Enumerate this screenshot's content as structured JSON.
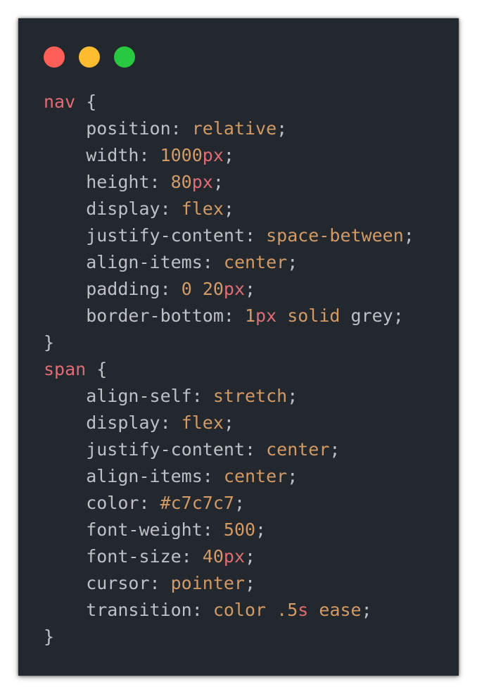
{
  "window": {
    "controls": [
      {
        "name": "close-dot",
        "color": "#ff5f57"
      },
      {
        "name": "minimize-dot",
        "color": "#febc2e"
      },
      {
        "name": "maximize-dot",
        "color": "#28c840"
      }
    ]
  },
  "colors": {
    "background": "#23272e",
    "selector": "#e06c75",
    "property": "#bdc1c6",
    "value": "#d19a66",
    "unit": "#e06c75"
  },
  "code": {
    "lines": [
      [
        {
          "t": "nav",
          "k": "sel"
        },
        {
          "t": " {",
          "k": "punc"
        }
      ],
      [
        {
          "t": "    position",
          "k": "prop"
        },
        {
          "t": ": ",
          "k": "punc"
        },
        {
          "t": "relative",
          "k": "val"
        },
        {
          "t": ";",
          "k": "punc"
        }
      ],
      [
        {
          "t": "    width",
          "k": "prop"
        },
        {
          "t": ": ",
          "k": "punc"
        },
        {
          "t": "1000",
          "k": "val"
        },
        {
          "t": "px",
          "k": "unit"
        },
        {
          "t": ";",
          "k": "punc"
        }
      ],
      [
        {
          "t": "    height",
          "k": "prop"
        },
        {
          "t": ": ",
          "k": "punc"
        },
        {
          "t": "80",
          "k": "val"
        },
        {
          "t": "px",
          "k": "unit"
        },
        {
          "t": ";",
          "k": "punc"
        }
      ],
      [
        {
          "t": "    display",
          "k": "prop"
        },
        {
          "t": ": ",
          "k": "punc"
        },
        {
          "t": "flex",
          "k": "val"
        },
        {
          "t": ";",
          "k": "punc"
        }
      ],
      [
        {
          "t": "    justify-content",
          "k": "prop"
        },
        {
          "t": ": ",
          "k": "punc"
        },
        {
          "t": "space-between",
          "k": "val"
        },
        {
          "t": ";",
          "k": "punc"
        }
      ],
      [
        {
          "t": "    align-items",
          "k": "prop"
        },
        {
          "t": ": ",
          "k": "punc"
        },
        {
          "t": "center",
          "k": "val"
        },
        {
          "t": ";",
          "k": "punc"
        }
      ],
      [
        {
          "t": "    padding",
          "k": "prop"
        },
        {
          "t": ": ",
          "k": "punc"
        },
        {
          "t": "0",
          "k": "val"
        },
        {
          "t": " ",
          "k": "punc"
        },
        {
          "t": "20",
          "k": "val"
        },
        {
          "t": "px",
          "k": "unit"
        },
        {
          "t": ";",
          "k": "punc"
        }
      ],
      [
        {
          "t": "    border-bottom",
          "k": "prop"
        },
        {
          "t": ": ",
          "k": "punc"
        },
        {
          "t": "1",
          "k": "val"
        },
        {
          "t": "px",
          "k": "unit"
        },
        {
          "t": " ",
          "k": "punc"
        },
        {
          "t": "solid",
          "k": "val"
        },
        {
          "t": " grey;",
          "k": "punc"
        }
      ],
      [
        {
          "t": "}",
          "k": "punc"
        }
      ],
      [
        {
          "t": "span",
          "k": "sel"
        },
        {
          "t": " {",
          "k": "punc"
        }
      ],
      [
        {
          "t": "    align-self",
          "k": "prop"
        },
        {
          "t": ": ",
          "k": "punc"
        },
        {
          "t": "stretch",
          "k": "val"
        },
        {
          "t": ";",
          "k": "punc"
        }
      ],
      [
        {
          "t": "    display",
          "k": "prop"
        },
        {
          "t": ": ",
          "k": "punc"
        },
        {
          "t": "flex",
          "k": "val"
        },
        {
          "t": ";",
          "k": "punc"
        }
      ],
      [
        {
          "t": "    justify-content",
          "k": "prop"
        },
        {
          "t": ": ",
          "k": "punc"
        },
        {
          "t": "center",
          "k": "val"
        },
        {
          "t": ";",
          "k": "punc"
        }
      ],
      [
        {
          "t": "    align-items",
          "k": "prop"
        },
        {
          "t": ": ",
          "k": "punc"
        },
        {
          "t": "center",
          "k": "val"
        },
        {
          "t": ";",
          "k": "punc"
        }
      ],
      [
        {
          "t": "    color",
          "k": "prop"
        },
        {
          "t": ": ",
          "k": "punc"
        },
        {
          "t": "#c7c7c7",
          "k": "val"
        },
        {
          "t": ";",
          "k": "punc"
        }
      ],
      [
        {
          "t": "    font-weight",
          "k": "prop"
        },
        {
          "t": ": ",
          "k": "punc"
        },
        {
          "t": "500",
          "k": "val"
        },
        {
          "t": ";",
          "k": "punc"
        }
      ],
      [
        {
          "t": "    font-size",
          "k": "prop"
        },
        {
          "t": ": ",
          "k": "punc"
        },
        {
          "t": "40",
          "k": "val"
        },
        {
          "t": "px",
          "k": "unit"
        },
        {
          "t": ";",
          "k": "punc"
        }
      ],
      [
        {
          "t": "    cursor",
          "k": "prop"
        },
        {
          "t": ": ",
          "k": "punc"
        },
        {
          "t": "pointer",
          "k": "val"
        },
        {
          "t": ";",
          "k": "punc"
        }
      ],
      [
        {
          "t": "    transition",
          "k": "prop"
        },
        {
          "t": ": ",
          "k": "punc"
        },
        {
          "t": "color",
          "k": "val"
        },
        {
          "t": " ",
          "k": "punc"
        },
        {
          "t": ".5",
          "k": "val"
        },
        {
          "t": "s",
          "k": "unit"
        },
        {
          "t": " ",
          "k": "punc"
        },
        {
          "t": "ease",
          "k": "val"
        },
        {
          "t": ";",
          "k": "punc"
        }
      ],
      [
        {
          "t": "}",
          "k": "punc"
        }
      ]
    ]
  }
}
